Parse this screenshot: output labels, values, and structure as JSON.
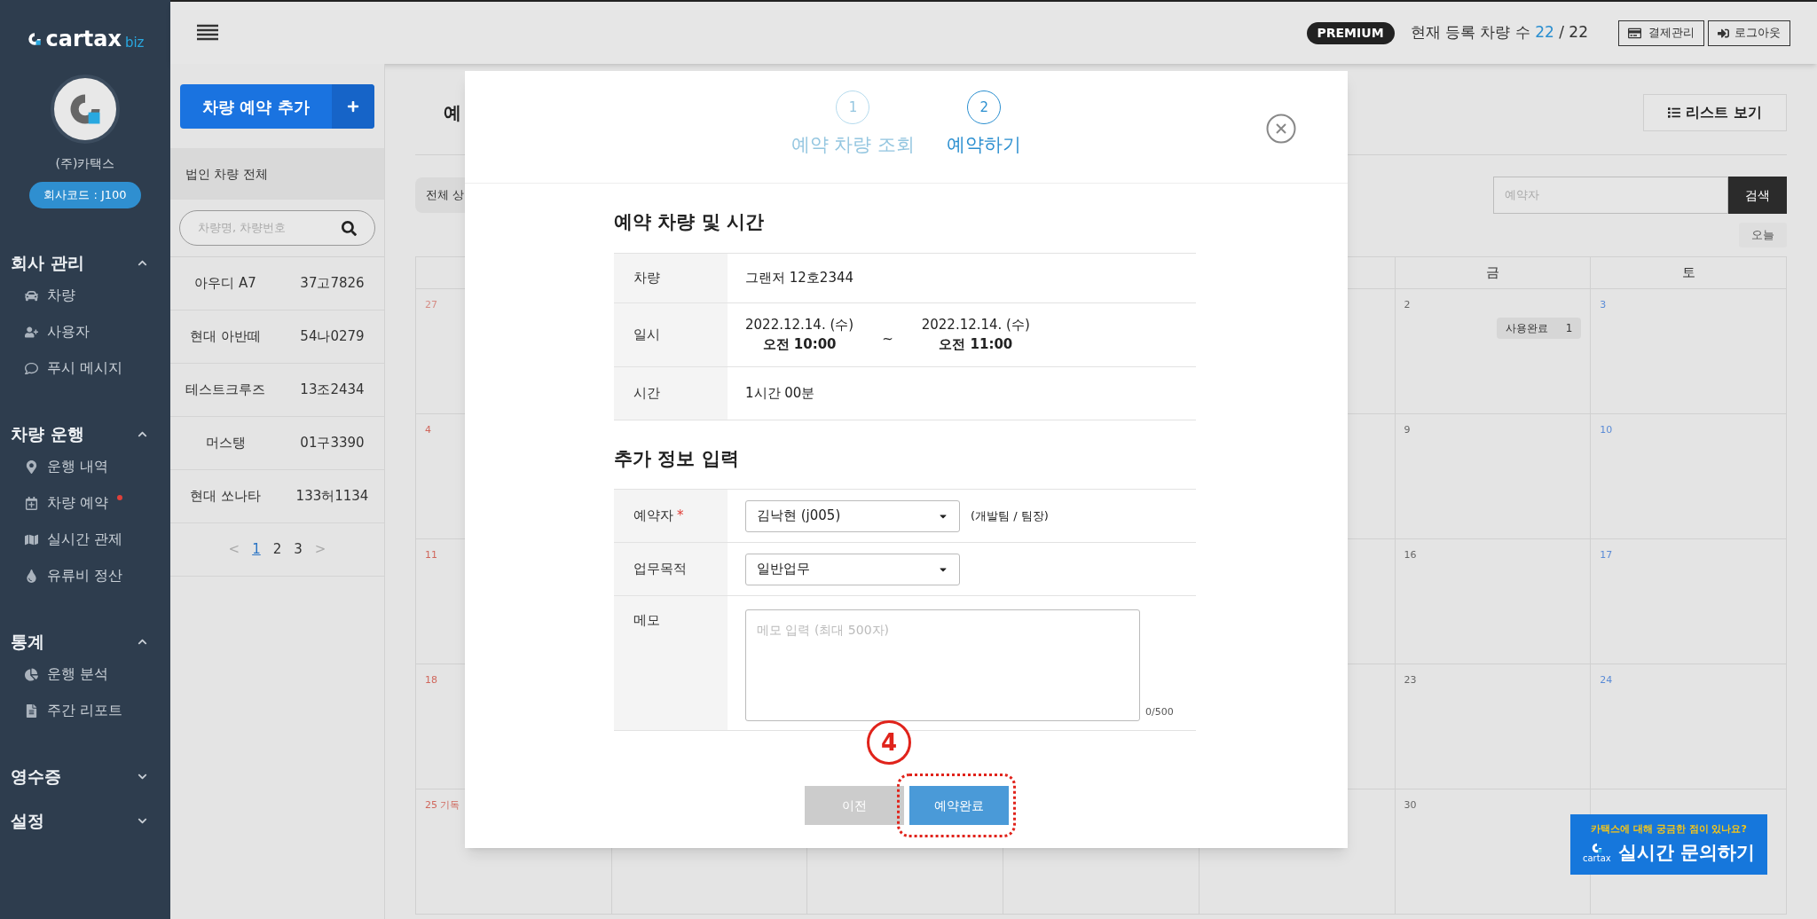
{
  "sidebar": {
    "logo": {
      "word": "cartax",
      "suffix": "biz"
    },
    "company": "(주)카택스",
    "code": "회사코드 : J100",
    "sections": [
      {
        "title": "회사 관리",
        "expanded": true,
        "items": [
          {
            "label": "차량",
            "new": false
          },
          {
            "label": "사용자",
            "new": false
          },
          {
            "label": "푸시 메시지",
            "new": false
          }
        ]
      },
      {
        "title": "차량 운행",
        "expanded": true,
        "items": [
          {
            "label": "운행 내역",
            "new": false
          },
          {
            "label": "차량 예약",
            "new": true
          },
          {
            "label": "실시간 관제",
            "new": false
          },
          {
            "label": "유류비 정산",
            "new": false
          }
        ]
      },
      {
        "title": "통계",
        "expanded": true,
        "items": [
          {
            "label": "운행 분석",
            "new": false
          },
          {
            "label": "주간 리포트",
            "new": false
          }
        ]
      },
      {
        "title": "영수증",
        "expanded": false
      },
      {
        "title": "설정",
        "expanded": false
      }
    ]
  },
  "topbar": {
    "plan": "PREMIUM",
    "count_label": "현재 등록 차량 수",
    "count_current": "22",
    "count_total": "/ 22",
    "buttons": [
      "결제관리",
      "로그아웃"
    ]
  },
  "vehicle_panel": {
    "add_button": "차량 예약 추가",
    "group": "법인 차량 전체",
    "search": {
      "placeholder": "차량명, 차량번호"
    },
    "vehicles": [
      {
        "name": "아우디 A7",
        "plate": "37고7826"
      },
      {
        "name": "현대 아반떼",
        "plate": "54나0279"
      },
      {
        "name": "테스트크루즈",
        "plate": "13조2434"
      },
      {
        "name": "머스탱",
        "plate": "01구3390"
      },
      {
        "name": "현대 쏘나타",
        "plate": "133허1134"
      }
    ],
    "prev": "<",
    "next": ">",
    "pages": [
      {
        "label": "1",
        "selected": true
      },
      {
        "label": "2",
        "selected": false
      },
      {
        "label": "3",
        "selected": false
      }
    ]
  },
  "main": {
    "title": "예",
    "list_button": "리스트 보기",
    "filter_chip": "전체 상",
    "search": {
      "placeholder": "예약자",
      "button": "검색"
    },
    "today_button": "오늘",
    "weekdays": [
      {
        "label": "금",
        "kind": "fri"
      },
      {
        "label": "토",
        "kind": "sat"
      }
    ],
    "weeks": [
      {
        "cells": [
          {
            "kind": "sun",
            "day": "27",
            "muted": true
          },
          {
            "kind": "fri",
            "day": "2",
            "muted": false,
            "event": {
              "label": "사용완료",
              "count": "1"
            }
          },
          {
            "kind": "sat",
            "day": "3",
            "muted": false
          }
        ]
      },
      {
        "cells": [
          {
            "kind": "sun",
            "day": "4",
            "muted": false
          },
          {
            "kind": "fri",
            "day": "9",
            "muted": false
          },
          {
            "kind": "sat",
            "day": "10",
            "muted": false
          }
        ]
      },
      {
        "cells": [
          {
            "kind": "sun",
            "day": "11",
            "muted": false
          },
          {
            "kind": "fri",
            "day": "16",
            "muted": false
          },
          {
            "kind": "sat",
            "day": "17",
            "muted": false
          }
        ]
      },
      {
        "cells": [
          {
            "kind": "sun",
            "day": "18",
            "muted": false
          },
          {
            "kind": "fri",
            "day": "23",
            "muted": false
          },
          {
            "kind": "sat",
            "day": "24",
            "muted": false
          }
        ]
      },
      {
        "cells": [
          {
            "kind": "sun",
            "day": "25 기독",
            "muted": false
          },
          {
            "kind": "fri",
            "day": "30",
            "muted": false
          }
        ]
      }
    ]
  },
  "modal": {
    "steps": [
      {
        "number": "1",
        "label": "예약 차량 조회",
        "selected": false
      },
      {
        "number": "2",
        "label": "예약하기",
        "selected": true
      }
    ],
    "section1": {
      "title": "예약 차량 및 시간",
      "vehicle_label": "차량",
      "vehicle": "그랜저 12호2344",
      "datetime_label": "일시",
      "start_date": "2022.12.14. (수)",
      "start_time": "오전 10:00",
      "separator": "~",
      "end_date": "2022.12.14. (수)",
      "end_time": "오전 11:00",
      "duration_label": "시간",
      "duration": "1시간 00분"
    },
    "section2": {
      "title": "추가 정보 입력",
      "booker_label": "예약자",
      "booker_required": "*",
      "booker": "김낙현 (j005)",
      "booker_note": "(개발팀 / 팀장)",
      "purpose_label": "업무목적",
      "purpose": "일반업무",
      "memo_label": "메모",
      "memo": {
        "placeholder": "메모 입력 (최대 500자)"
      },
      "memo_count": "0/500"
    },
    "buttons": [
      {
        "label": "이전",
        "disabled": true
      },
      {
        "label": "예약완료",
        "disabled": false
      }
    ],
    "annotation": {
      "step": "4"
    }
  },
  "chat_banner": {
    "question": "카택스에 대해 궁금한 점이 있나요?",
    "logo": "cartax",
    "action": "실시간 문의하기"
  }
}
